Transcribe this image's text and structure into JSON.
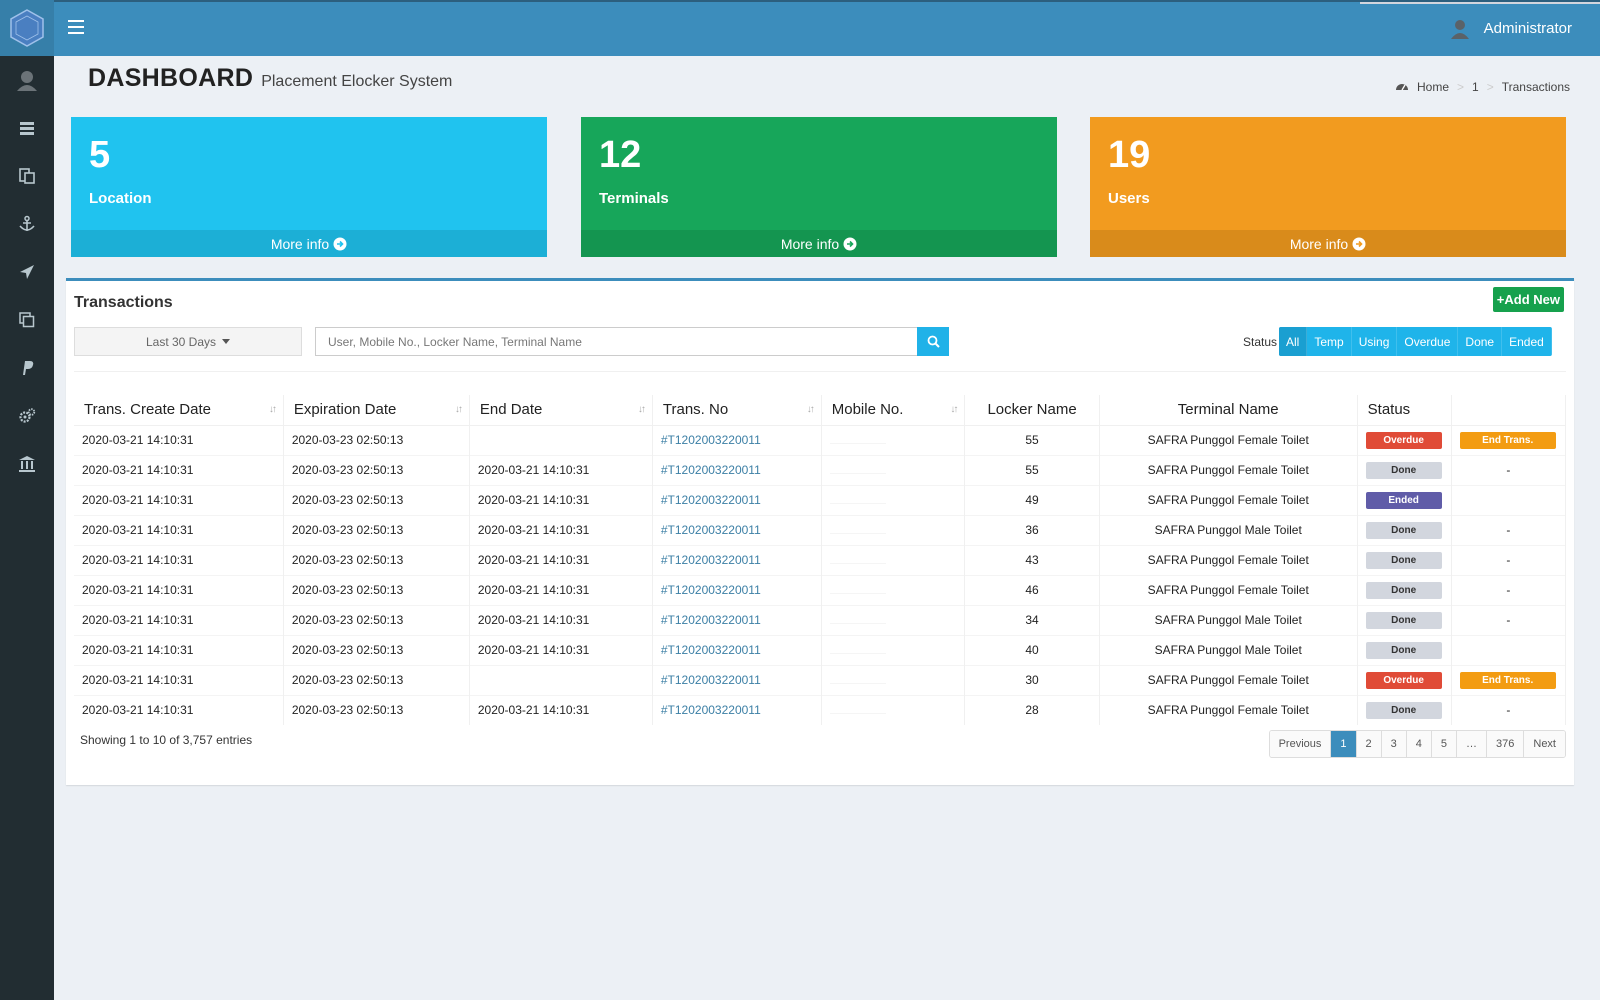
{
  "header": {
    "user_name": "Administrator"
  },
  "content": {
    "title": "DASHBOARD",
    "subtitle": "Placement Elocker System"
  },
  "breadcrumb": {
    "home": "Home",
    "level1": "1",
    "current": "Transactions"
  },
  "stats": [
    {
      "number": "5",
      "label": "Location",
      "more": "More info",
      "color": "#20c3ef"
    },
    {
      "number": "12",
      "label": "Terminals",
      "more": "More info",
      "color": "#17a65a"
    },
    {
      "number": "19",
      "label": "Users",
      "more": "More info",
      "color": "#f29b1f"
    }
  ],
  "transactions": {
    "title": "Transactions",
    "add_new": "+Add New",
    "date_filter": "Last 30 Days",
    "search_placeholder": "User, Mobile No., Locker Name, Terminal Name",
    "status_label": "Status",
    "status_filters": [
      "All",
      "Temp",
      "Using",
      "Overdue",
      "Done",
      "Ended"
    ],
    "columns": [
      "Trans. Create Date",
      "Expiration Date",
      "End Date",
      "Trans. No",
      "Mobile No.",
      "Locker Name",
      "Terminal Name",
      "Status"
    ],
    "rows": [
      {
        "create": "2020-03-21 14:10:31",
        "expire": "2020-03-23 02:50:13",
        "end": "",
        "trans_no": "#T1202003220011",
        "locker": "55",
        "terminal": "SAFRA Punggol Female Toilet",
        "status": "Overdue",
        "action": "End Trans."
      },
      {
        "create": "2020-03-21 14:10:31",
        "expire": "2020-03-23 02:50:13",
        "end": "2020-03-21 14:10:31",
        "trans_no": "#T1202003220011",
        "locker": "55",
        "terminal": "SAFRA Punggol Female Toilet",
        "status": "Done",
        "action": "-"
      },
      {
        "create": "2020-03-21 14:10:31",
        "expire": "2020-03-23 02:50:13",
        "end": "2020-03-21 14:10:31",
        "trans_no": "#T1202003220011",
        "locker": "49",
        "terminal": "SAFRA Punggol Female Toilet",
        "status": "Ended",
        "action": ""
      },
      {
        "create": "2020-03-21 14:10:31",
        "expire": "2020-03-23 02:50:13",
        "end": "2020-03-21 14:10:31",
        "trans_no": "#T1202003220011",
        "locker": "36",
        "terminal": "SAFRA Punggol Male Toilet",
        "status": "Done",
        "action": "-"
      },
      {
        "create": "2020-03-21 14:10:31",
        "expire": "2020-03-23 02:50:13",
        "end": "2020-03-21 14:10:31",
        "trans_no": "#T1202003220011",
        "locker": "43",
        "terminal": "SAFRA Punggol Female Toilet",
        "status": "Done",
        "action": "-"
      },
      {
        "create": "2020-03-21 14:10:31",
        "expire": "2020-03-23 02:50:13",
        "end": "2020-03-21 14:10:31",
        "trans_no": "#T1202003220011",
        "locker": "46",
        "terminal": "SAFRA Punggol Female Toilet",
        "status": "Done",
        "action": "-"
      },
      {
        "create": "2020-03-21 14:10:31",
        "expire": "2020-03-23 02:50:13",
        "end": "2020-03-21 14:10:31",
        "trans_no": "#T1202003220011",
        "locker": "34",
        "terminal": "SAFRA Punggol Male Toilet",
        "status": "Done",
        "action": "-"
      },
      {
        "create": "2020-03-21 14:10:31",
        "expire": "2020-03-23 02:50:13",
        "end": "2020-03-21 14:10:31",
        "trans_no": "#T1202003220011",
        "locker": "40",
        "terminal": "SAFRA Punggol Male Toilet",
        "status": "Done",
        "action": ""
      },
      {
        "create": "2020-03-21 14:10:31",
        "expire": "2020-03-23 02:50:13",
        "end": "",
        "trans_no": "#T1202003220011",
        "locker": "30",
        "terminal": "SAFRA Punggol Female Toilet",
        "status": "Overdue",
        "action": "End Trans."
      },
      {
        "create": "2020-03-21 14:10:31",
        "expire": "2020-03-23 02:50:13",
        "end": "2020-03-21 14:10:31",
        "trans_no": "#T1202003220011",
        "locker": "28",
        "terminal": "SAFRA Punggol Female Toilet",
        "status": "Done",
        "action": "-"
      }
    ],
    "entries_info": "Showing 1 to 10 of 3,757 entries",
    "pagination": [
      "Previous",
      "1",
      "2",
      "3",
      "4",
      "5",
      "…",
      "376",
      "Next"
    ],
    "active_page": "1"
  },
  "colors": {
    "topbar": "#3c8dbc",
    "sidebar": "#222d32",
    "overdue": "#e04b37",
    "ended": "#605ca8",
    "done": "#d2d6de",
    "end_trans": "#f39c12",
    "add_new": "#16a14d"
  },
  "icons": {
    "sidebar": [
      "avatar-icon",
      "list-icon",
      "locker-icon",
      "anchor-icon",
      "send-icon",
      "copy-icon",
      "paypal-icon",
      "gears-icon",
      "bank-icon"
    ]
  }
}
